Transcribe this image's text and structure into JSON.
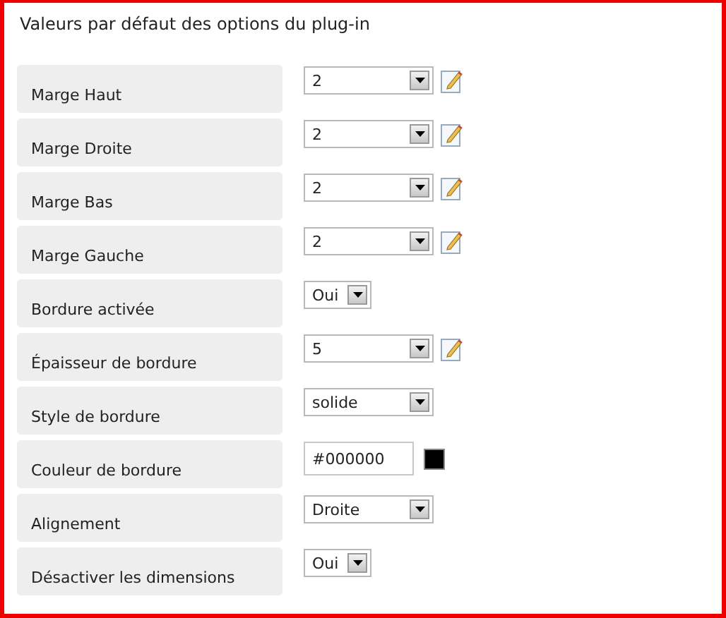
{
  "title": "Valeurs par défaut des options du plug-in",
  "options": [
    {
      "label": "Marge Haut",
      "kind": "select",
      "value": "2",
      "editable": true
    },
    {
      "label": "Marge Droite",
      "kind": "select",
      "value": "2",
      "editable": true
    },
    {
      "label": "Marge Bas",
      "kind": "select",
      "value": "2",
      "editable": true
    },
    {
      "label": "Marge Gauche",
      "kind": "select",
      "value": "2",
      "editable": true
    },
    {
      "label": "Bordure activée",
      "kind": "small-select",
      "value": "Oui",
      "editable": false
    },
    {
      "label": "Épaisseur de bordure",
      "kind": "select",
      "value": "5",
      "editable": true
    },
    {
      "label": "Style de bordure",
      "kind": "select",
      "value": "solide",
      "editable": false
    },
    {
      "label": "Couleur de bordure",
      "kind": "color",
      "value": "#000000",
      "color": "#000000",
      "editable": false
    },
    {
      "label": "Alignement",
      "kind": "select",
      "value": "Droite",
      "editable": false
    },
    {
      "label": "Désactiver les dimensions",
      "kind": "small-select",
      "value": "Oui",
      "editable": false
    }
  ]
}
